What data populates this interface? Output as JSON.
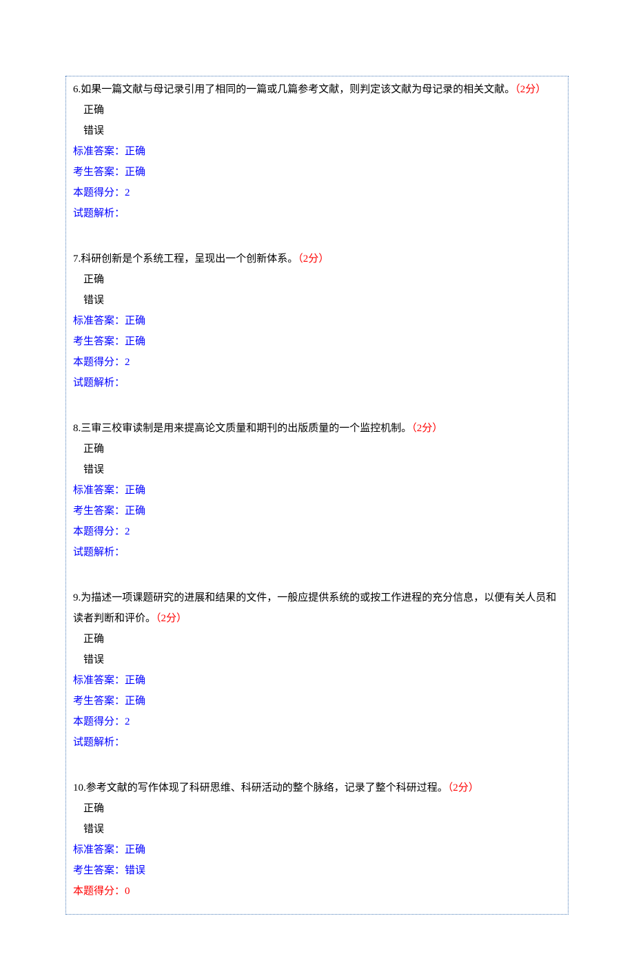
{
  "labels": {
    "standard_answer": "标准答案：",
    "candidate_answer": "考生答案：",
    "score_earned": "本题得分：",
    "analysis": "试题解析："
  },
  "options": {
    "correct": "正确",
    "incorrect": "错误"
  },
  "questions": [
    {
      "num": "6.",
      "text": "如果一篇文献与母记录引用了相同的一篇或几篇参考文献，则判定该文献为母记录的相关文献。",
      "points": "（2分）",
      "standard": "正确",
      "candidate": "正确",
      "score": "2",
      "score_wrong": false,
      "analysis": ""
    },
    {
      "num": "7.",
      "text": "科研创新是个系统工程，呈现出一个创新体系。",
      "points": "（2分）",
      "standard": "正确",
      "candidate": "正确",
      "score": "2",
      "score_wrong": false,
      "analysis": ""
    },
    {
      "num": "8.",
      "text": "三审三校审读制是用来提高论文质量和期刊的出版质量的一个监控机制。",
      "points": "（2分）",
      "standard": "正确",
      "candidate": "正确",
      "score": "2",
      "score_wrong": false,
      "analysis": ""
    },
    {
      "num": "9.",
      "text": "为描述一项课题研究的进展和结果的文件，一般应提供系统的或按工作进程的充分信息，以便有关人员和读者判断和评价。",
      "points": "（2分）",
      "standard": "正确",
      "candidate": "正确",
      "score": "2",
      "score_wrong": false,
      "analysis": ""
    },
    {
      "num": "10.",
      "text": "参考文献的写作体现了科研思维、科研活动的整个脉络，记录了整个科研过程。",
      "points": "（2分）",
      "standard": "正确",
      "candidate": "错误",
      "score": "0",
      "score_wrong": true,
      "analysis": ""
    }
  ]
}
